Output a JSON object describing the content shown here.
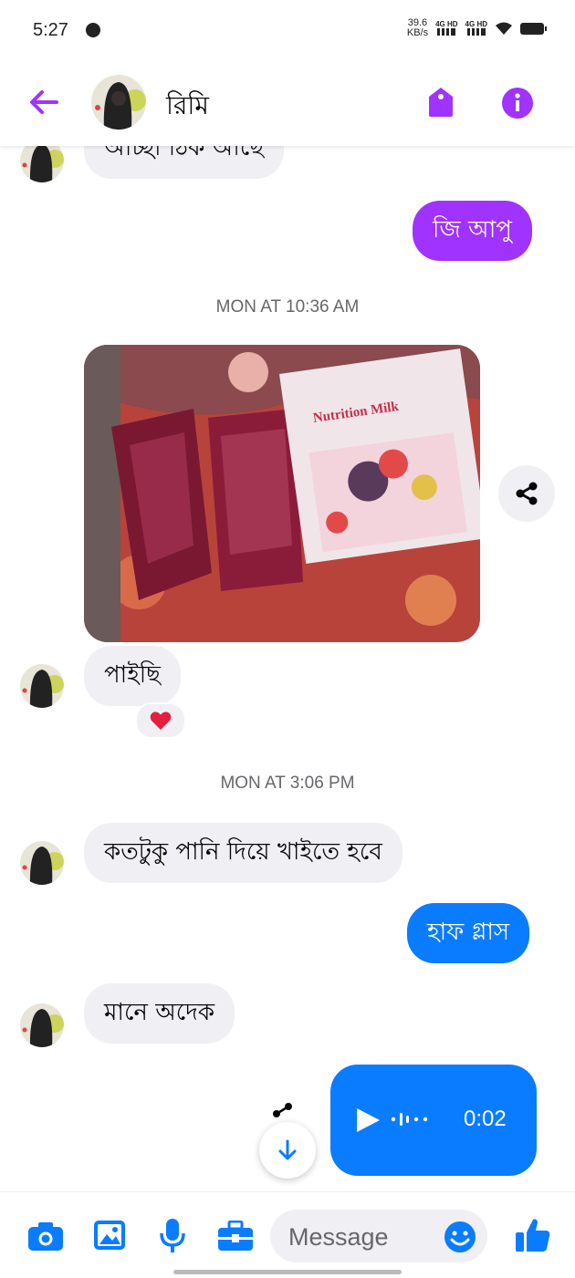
{
  "status_bar": {
    "time": "5:27",
    "speed_value": "39.6",
    "speed_unit": "KB/s",
    "network_1": "4G HD",
    "network_2": "4G HD"
  },
  "header": {
    "contact_name": "রিমি"
  },
  "messages": {
    "partial_incoming": "আচ্ছা ঠিক আছে",
    "outgoing_1": "জি আপু",
    "timestamp_1": "MON AT 10:36 AM",
    "photo_label": "Nutrition Milk",
    "incoming_2": "পাইছি",
    "timestamp_2": "MON AT 3:06 PM",
    "incoming_3": "কতটুকু পানি দিয়ে খাইতে হবে",
    "outgoing_2": "হাফ গ্লাস",
    "incoming_4": "মানে অদেক",
    "voice_duration": "0:02"
  },
  "composer": {
    "placeholder": "Message"
  },
  "colors": {
    "accent_purple": "#a033ff",
    "accent_blue": "#0a7cff",
    "incoming_bubble": "#f0eff4"
  }
}
